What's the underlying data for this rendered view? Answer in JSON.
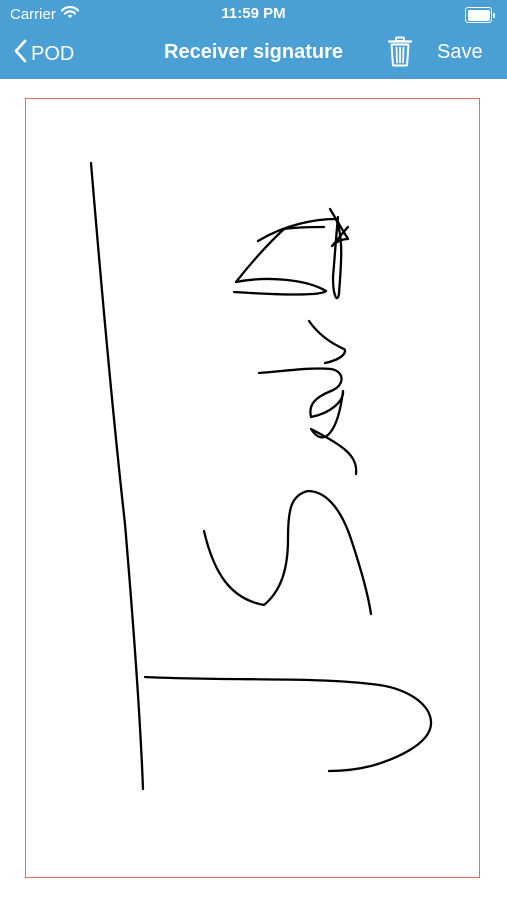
{
  "status_bar": {
    "carrier": "Carrier",
    "time": "11:59 PM",
    "wifi_icon": "wifi-icon",
    "battery_icon": "battery-icon"
  },
  "nav_bar": {
    "back_label": "POD",
    "back_icon": "chevron-left-icon",
    "title": "Receiver signature",
    "trash_icon": "trash-icon",
    "save_label": "Save"
  },
  "colors": {
    "nav_background": "#4a9fd5",
    "nav_text": "#ffffff",
    "pad_border": "#e8735c",
    "ink": "#000000"
  },
  "signature_pad": {
    "state": "signed"
  }
}
